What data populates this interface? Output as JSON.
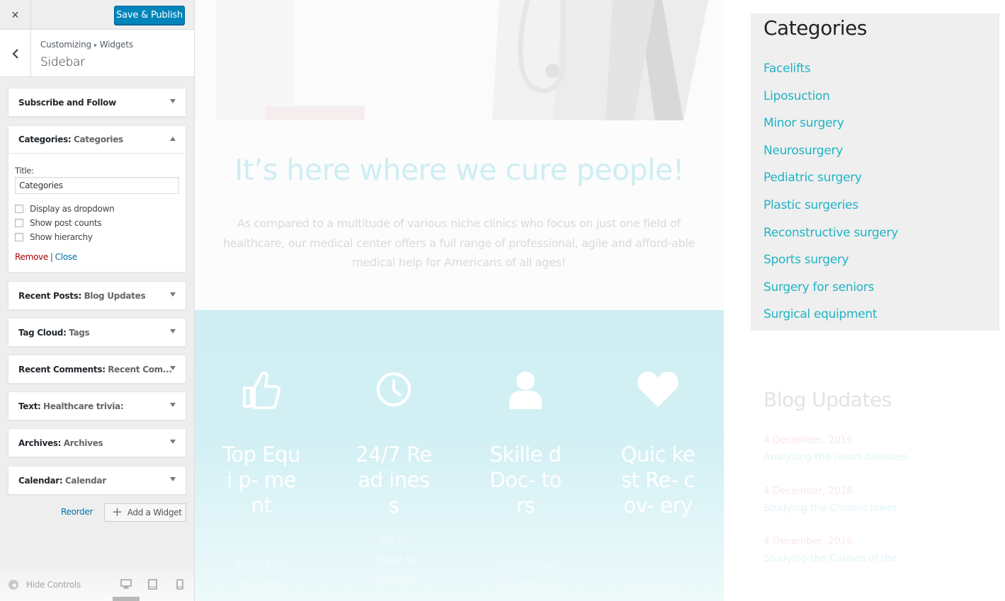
{
  "customizer": {
    "close_label": "×",
    "save_label": "Save & Publish",
    "breadcrumb": {
      "root": "Customizing",
      "separator": "▸",
      "section": "Widgets"
    },
    "section_title": "Sidebar",
    "widgets": [
      {
        "type": "Subscribe and Follow",
        "title": ""
      },
      {
        "type": "Categories:",
        "title": "Categories"
      },
      {
        "type": "Recent Posts:",
        "title": "Blog Updates"
      },
      {
        "type": "Tag Cloud:",
        "title": "Tags"
      },
      {
        "type": "Recent Comments:",
        "title": "Recent Com..."
      },
      {
        "type": "Text:",
        "title": "Healthcare trivia:"
      },
      {
        "type": "Archives:",
        "title": "Archives"
      },
      {
        "type": "Calendar:",
        "title": "Calendar"
      }
    ],
    "categories_form": {
      "title_label": "Title:",
      "title_value": "Categories",
      "options": [
        "Display as dropdown",
        "Show post counts",
        "Show hierarchy"
      ],
      "remove_label": "Remove",
      "separator": "|",
      "close_label": "Close"
    },
    "reorder_label": "Reorder",
    "add_widget_label": "Add a Widget",
    "hide_controls_label": "Hide Controls",
    "accent_color": "#0085ba"
  },
  "preview": {
    "headline": "It’s here where we cure people!",
    "intro": "As compared to a multitude of various niche clinics who focus on just one field of healthcare, our medical center offers a full range of professional, agile and afford-able medical help for Americans of all ages!",
    "features": [
      {
        "icon": "thumbs-up-icon",
        "title": "Top Equi p- ment",
        "desc": "Our clinic has the"
      },
      {
        "icon": "clock-icon",
        "title": "24/7 Read iness",
        "desc": "We're ready to come to"
      },
      {
        "icon": "user-icon",
        "title": "Skille d Doc- tors",
        "desc": "During our 25 years in"
      },
      {
        "icon": "heart-icon",
        "title": "Quic kest Re- cov- ery",
        "desc": "Consult"
      }
    ],
    "categories_widget": {
      "title": "Categories",
      "items": [
        "Facelifts",
        "Liposuction",
        "Minor surgery",
        "Neurosurgery",
        "Pediatric surgery",
        "Plastic surgeries",
        "Reconstructive surgery",
        "Sports surgery",
        "Surgery for seniors",
        "Surgical equipment"
      ]
    },
    "blog_widget": {
      "title": "Blog Updates",
      "posts": [
        {
          "date": "4 December, 2016",
          "title": "Analyzing the Heart diseases"
        },
        {
          "date": "4 December, 2016",
          "title": "Studying the Chronic lower"
        },
        {
          "date": "4 December, 2016",
          "title": "Studying the Causes of the"
        }
      ]
    },
    "link_color": "#1fb4c4"
  }
}
